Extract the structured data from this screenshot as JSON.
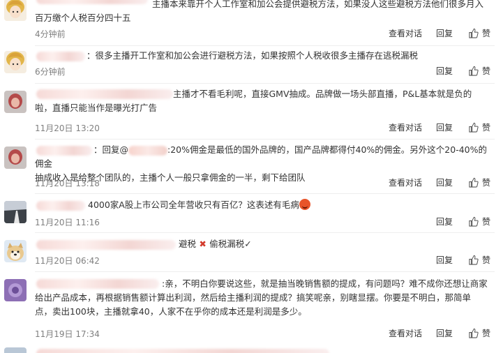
{
  "actions": {
    "view_conversation": "查看对话",
    "reply": "回复",
    "like": "赞"
  },
  "colors": {
    "meta": "#808080",
    "text": "#333333",
    "divider": "#eeeeee",
    "emoji": "#e8542a",
    "cross": "#d33a2c"
  },
  "comments": [
    {
      "line1": "主播本来靠开个人工作室和加公会提供避税方法，如果没人这些避税方法他们很多月入",
      "line2": "百万缴个人税百分四十五",
      "time": "4分钟前",
      "show_view": true,
      "avatar_icon": "cartoon-girl-avatar-icon"
    },
    {
      "line1": "：很多主播开工作室和加公会进行避税方法，如果按照个人税收很多主播存在逃税漏税",
      "time": "6分钟前",
      "show_view": false,
      "avatar_icon": "cartoon-girl-avatar-icon"
    },
    {
      "line1": "主播才不看毛利呢，直接GMV抽成。品牌做一场头部直播，P&L基本就是负的",
      "line2": "啦，直播只能当作是曝光打广告",
      "time": "11月20日 13:20",
      "show_view": true,
      "avatar_icon": "portrait-avatar-icon"
    },
    {
      "prefix": "：回复@",
      "line1": ":20%佣金是最低的国外品牌的，国产品牌都得付40%的佣金。另外这个20-40%的佣金",
      "line2": "抽成收入是给整个团队的，主播个人一般只拿佣金的一半，剩下给团队",
      "time": "11月20日 13:18",
      "show_view": true,
      "avatar_icon": "portrait-avatar-icon"
    },
    {
      "line1": "4000家A股上市公司全年营收只有百亿？这表述有毛病",
      "time": "11月20日 11:16",
      "show_view": false,
      "avatar_icon": "road-landscape-avatar-icon"
    },
    {
      "line1": "避税",
      "line1b": "偷税漏税✓",
      "time": "11月20日 06:42",
      "show_view": false,
      "avatar_icon": "dog-avatar-icon"
    },
    {
      "line1": ":亲，不明白你要说这些，就是抽当晚销售额的提成，有问题吗？难不成你还想让商家",
      "line2": "给出产品成本，再根据销售额计算出利润，然后给主播利润的提成？搞笑呢亲，别瞎显摆。你要是不明白，那简单",
      "line3": "点，卖出100块，主播就拿40，人家不在乎你的成本还是利润是多少。",
      "time": "11月19日 17:34",
      "show_view": true,
      "avatar_icon": "purple-avatar-icon"
    }
  ]
}
